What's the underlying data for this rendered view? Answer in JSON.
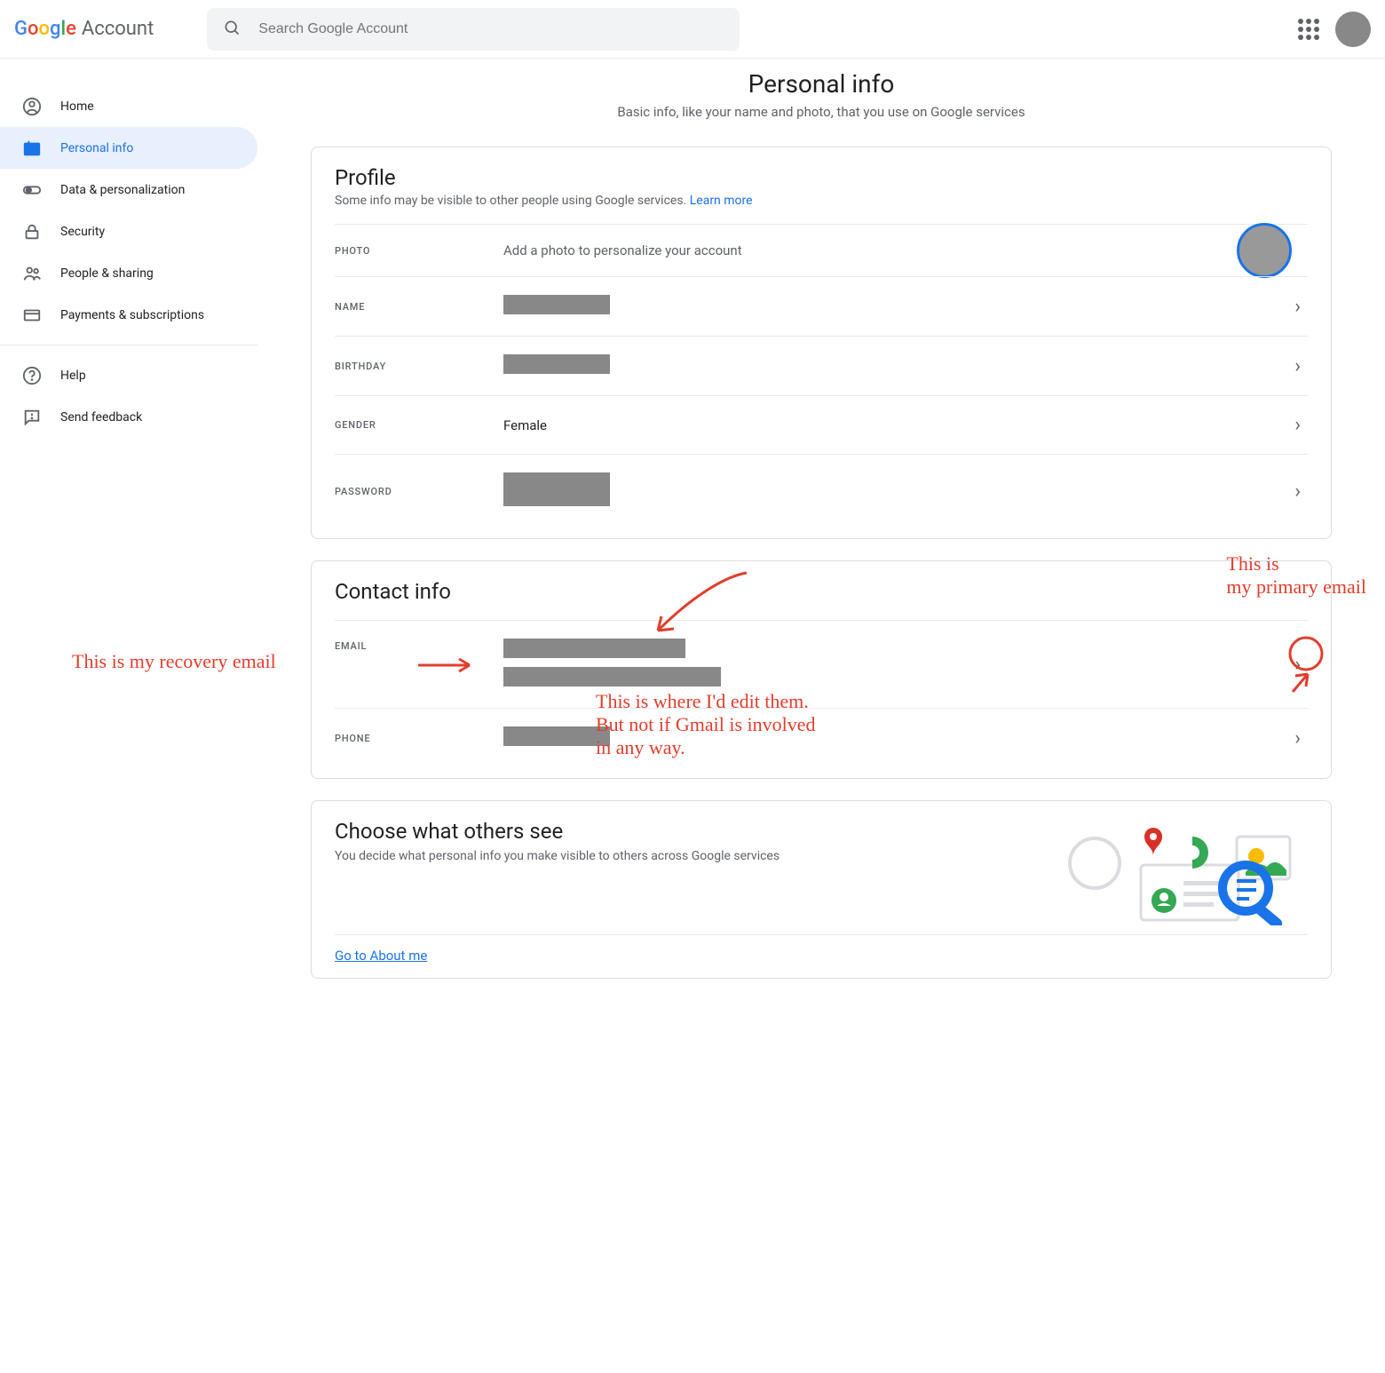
{
  "header": {
    "logo_text": "Account",
    "search_placeholder": "Search Google Account"
  },
  "sidebar": {
    "items": [
      {
        "label": "Home"
      },
      {
        "label": "Personal info"
      },
      {
        "label": "Data & personalization"
      },
      {
        "label": "Security"
      },
      {
        "label": "People & sharing"
      },
      {
        "label": "Payments & subscriptions"
      },
      {
        "label": "Help"
      },
      {
        "label": "Send feedback"
      }
    ]
  },
  "page": {
    "title": "Personal info",
    "subtitle": "Basic info, like your name and photo, that you use on Google services"
  },
  "profile": {
    "heading": "Profile",
    "sub": "Some info may be visible to other people using Google services. ",
    "learn_more": "Learn more",
    "rows": {
      "photo": {
        "label": "PHOTO",
        "value": "Add a photo to personalize your account"
      },
      "name": {
        "label": "NAME"
      },
      "birthday": {
        "label": "BIRTHDAY"
      },
      "gender": {
        "label": "GENDER",
        "value": "Female"
      },
      "password": {
        "label": "PASSWORD"
      }
    }
  },
  "contact": {
    "heading": "Contact info",
    "rows": {
      "email": {
        "label": "EMAIL"
      },
      "phone": {
        "label": "PHONE"
      }
    }
  },
  "choose": {
    "heading": "Choose what others see",
    "sub": "You decide what personal info you make visible to others across Google services",
    "link": "Go to About me"
  },
  "annotations": {
    "primary": "This is\nmy primary email",
    "recovery": "This is my recovery email",
    "edit": "This is where I'd edit them.\nBut not if Gmail is involved\nin any way."
  }
}
